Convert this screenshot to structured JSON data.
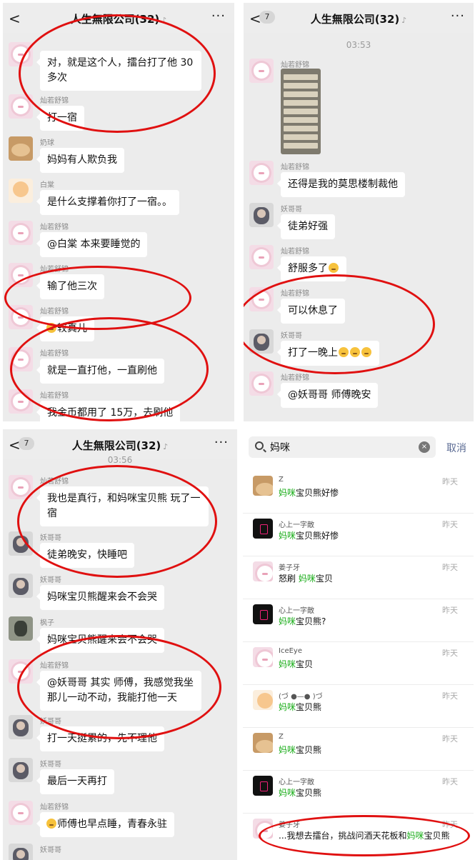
{
  "panel1": {
    "title": "人生無限公司(32)",
    "back": "<",
    "more": "···",
    "messages": [
      {
        "nick": "",
        "text": "对，就是这个人，擂台打了他 30 多次"
      },
      {
        "nick": "灿若舒锦",
        "text": "打一宿"
      },
      {
        "nick": "奶球",
        "text": "妈妈有人欺负我"
      },
      {
        "nick": "白棠",
        "text": "是什么支撑着你打了一宿。。"
      },
      {
        "nick": "灿若舒锦",
        "text": "@白棠 本来要睡觉的"
      },
      {
        "nick": "灿若舒锦",
        "text": "输了他三次"
      },
      {
        "nick": "灿若舒锦",
        "text": "较真儿"
      },
      {
        "nick": "灿若舒锦",
        "text": "就是一直打他，一直刷他"
      },
      {
        "nick": "灿若舒锦",
        "text": "我金币都用了 15万，去刷他"
      }
    ]
  },
  "panel2": {
    "title": "人生無限公司(32)",
    "back": "<",
    "badge": "7",
    "more": "···",
    "time": "03:53",
    "messages": [
      {
        "nick": "灿若舒锦",
        "text": ""
      },
      {
        "nick": "灿若舒锦",
        "text": "还得是我的莫思楼制裁他"
      },
      {
        "nick": "妖哥哥",
        "text": "徒弟好强"
      },
      {
        "nick": "灿若舒锦",
        "text": "舒服多了"
      },
      {
        "nick": "灿若舒锦",
        "text": "可以休息了"
      },
      {
        "nick": "妖哥哥",
        "text": "打了一晚上"
      },
      {
        "nick": "灿若舒锦",
        "text": "@妖哥哥 师傅晚安"
      }
    ]
  },
  "panel3": {
    "title": "人生無限公司(32)",
    "back": "<",
    "badge": "7",
    "more": "···",
    "time": "03:56",
    "messages": [
      {
        "nick": "灿若舒锦",
        "text": "我也是真行，和妈咪宝贝熊 玩了一宿"
      },
      {
        "nick": "妖哥哥",
        "text": "徒弟晚安，快睡吧"
      },
      {
        "nick": "妖哥哥",
        "text": "妈咪宝贝熊醒来会不会哭"
      },
      {
        "nick": "枫子",
        "text": "妈咪宝贝熊醒来会不会哭"
      },
      {
        "nick": "灿若舒锦",
        "text": "@妖哥哥 其实 师傅，我感觉我坐那儿一动不动，我能打他一天"
      },
      {
        "nick": "妖哥哥",
        "text": "打一天挺累的，先不理他"
      },
      {
        "nick": "妖哥哥",
        "text": "最后一天再打"
      },
      {
        "nick": "灿若舒锦",
        "text": "师傅也早点睡，青春永驻"
      },
      {
        "nick": "妖哥哥",
        "text": ""
      }
    ]
  },
  "panel4": {
    "search_value": "妈咪",
    "cancel": "取消",
    "clear": "×",
    "results": [
      {
        "name": "Z",
        "pre": "",
        "hl": "妈咪",
        "post": "宝贝熊好惨",
        "date": "昨天"
      },
      {
        "name": "心上一字敵",
        "pre": "",
        "hl": "妈咪",
        "post": "宝贝熊好惨",
        "date": "昨天"
      },
      {
        "name": "姜子牙",
        "pre": "怒刷 ",
        "hl": "妈咪",
        "post": "宝贝",
        "date": "昨天"
      },
      {
        "name": "心上一字敵",
        "pre": "",
        "hl": "妈咪",
        "post": "宝贝熊?",
        "date": "昨天"
      },
      {
        "name": "IceEye",
        "pre": "",
        "hl": "妈咪",
        "post": "宝贝",
        "date": "昨天"
      },
      {
        "name": "(づ ●—● )づ",
        "pre": "",
        "hl": "妈咪",
        "post": "宝贝熊",
        "date": "昨天"
      },
      {
        "name": "Z",
        "pre": "",
        "hl": "妈咪",
        "post": "宝贝熊",
        "date": "昨天"
      },
      {
        "name": "心上一字敵",
        "pre": "",
        "hl": "妈咪",
        "post": "宝贝熊",
        "date": "昨天"
      },
      {
        "name": "姜子牙",
        "pre": "...我想去擂台，挑战问酒天花板和",
        "hl": "妈咪",
        "post": "宝贝熊",
        "date": "昨天"
      }
    ]
  },
  "colors": {
    "highlight": "#1aad19",
    "ring": "#e01010",
    "chat_bg": "#ececec"
  }
}
